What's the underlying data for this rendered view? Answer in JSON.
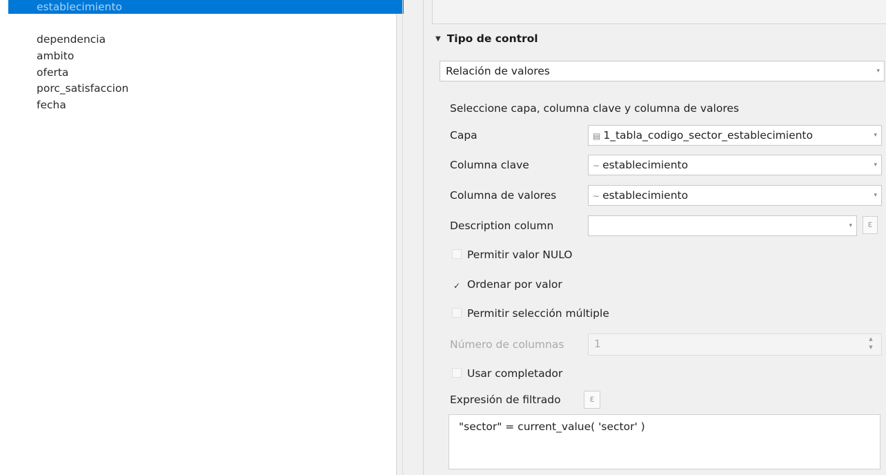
{
  "fields": [
    {
      "label": "establecimiento",
      "selected": true
    },
    {
      "label": "dependencia",
      "selected": false
    },
    {
      "label": "ambito",
      "selected": false
    },
    {
      "label": "oferta",
      "selected": false
    },
    {
      "label": "porc_satisfaccion",
      "selected": false
    },
    {
      "label": "fecha",
      "selected": false
    }
  ],
  "section": {
    "title": "Tipo de control",
    "collapse_icon": "triangle-down-icon"
  },
  "widget_type": {
    "value": "Relación de valores"
  },
  "relation": {
    "instructions": "Seleccione capa, columna clave y columna de valores",
    "layer_label": "Capa",
    "layer_value": "1_tabla_codigo_sector_establecimiento",
    "layer_icon": "table-icon",
    "key_label": "Columna clave",
    "key_value": "establecimiento",
    "value_label": "Columna de valores",
    "value_value": "establecimiento",
    "field_icon": "text-field-icon",
    "description_label": "Description column",
    "description_value": "",
    "expression_icon": "epsilon-icon"
  },
  "options": {
    "allow_null": {
      "label": "Permitir valor NULO",
      "checked": false
    },
    "order_by_value": {
      "label": "Ordenar por valor",
      "checked": true
    },
    "allow_multi": {
      "label": "Permitir selección múltiple",
      "checked": false
    },
    "columns_label": "Número de columnas",
    "columns_value": "1",
    "use_completer": {
      "label": "Usar completador",
      "checked": false
    }
  },
  "filter": {
    "label": "Expresión de filtrado",
    "expression": "\"sector\" = current_value( 'sector' )"
  }
}
